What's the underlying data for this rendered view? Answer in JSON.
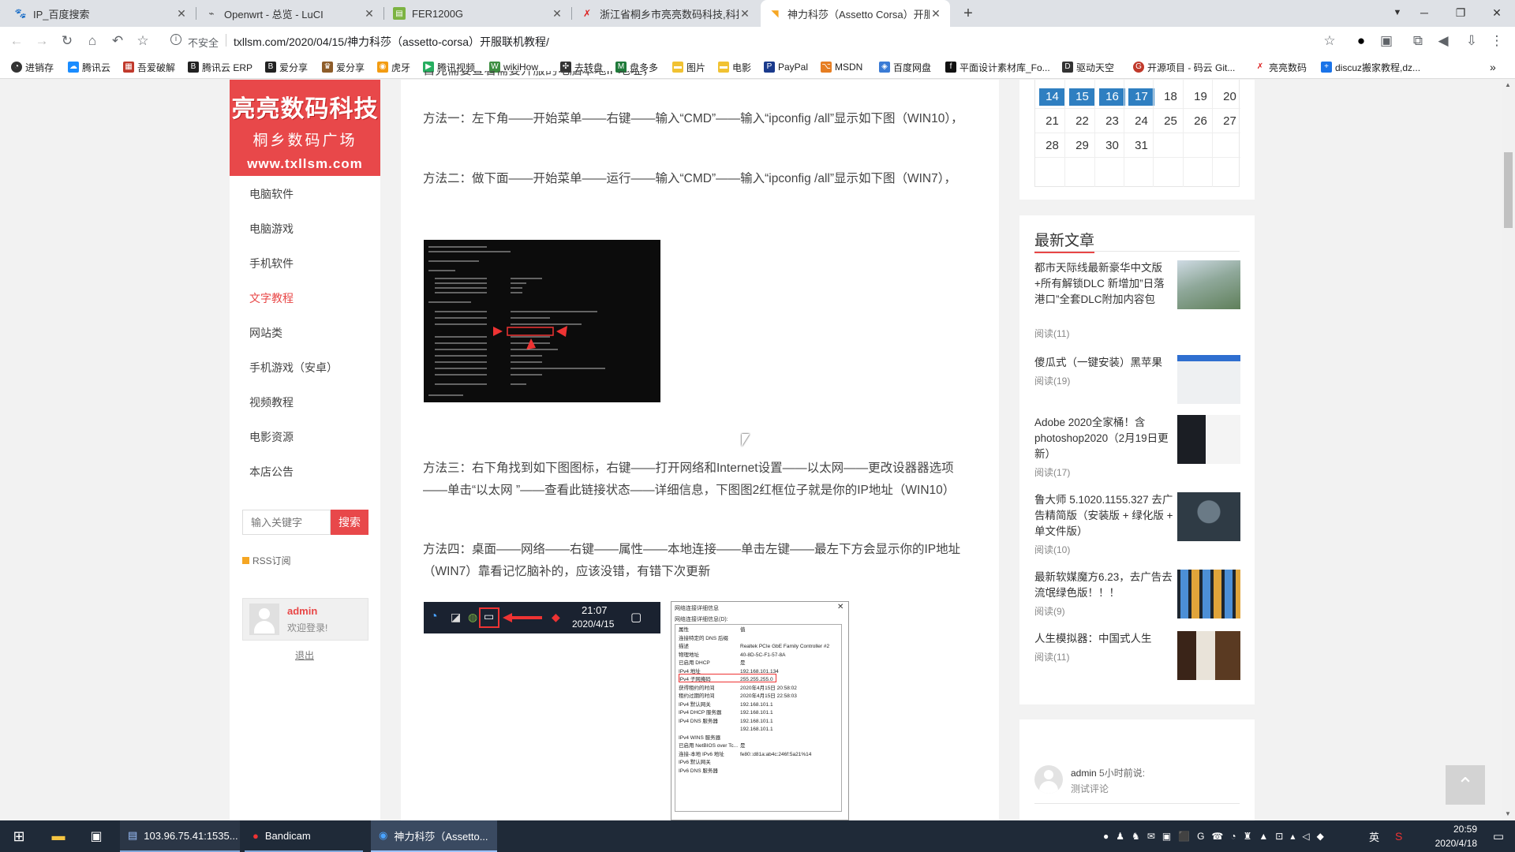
{
  "tabs": [
    {
      "title": "IP_百度搜索",
      "favicon": "baidu-icon"
    },
    {
      "title": "Openwrt - 总览 - LuCI",
      "favicon": "openwrt-icon"
    },
    {
      "title": "FER1200G",
      "favicon": "router-icon"
    },
    {
      "title": "浙江省桐乡市亮亮数码科技,科技",
      "favicon": "x-logo-icon"
    },
    {
      "title": "神力科莎（Assetto Corsa）开服",
      "favicon": "page-icon"
    }
  ],
  "omnibox": {
    "security": "不安全",
    "url": "txllsm.com/2020/04/15/神力科莎（assetto-corsa）开服联机教程/"
  },
  "bookmarks": [
    "进销存",
    "腾讯云",
    "吾爱破解",
    "腾讯云 ERP",
    "爱分享",
    "爱分享",
    "虎牙",
    "腾讯视频",
    "wikiHow",
    "去转盘",
    "盘多多",
    "图片",
    "电影",
    "PayPal",
    "MSDN",
    "百度网盘",
    "平面设计素材库_Fo...",
    "驱动天空",
    "开源项目 - 码云 Git...",
    "亮亮数码",
    "discuz搬家教程,dz..."
  ],
  "logo": {
    "line1": "亮亮数码科技",
    "line2": "桐乡数码广场",
    "line3": "www.txllsm.com"
  },
  "left_nav": [
    "电脑软件",
    "电脑游戏",
    "手机软件",
    "文字教程",
    "网站类",
    "手机游戏（安卓）",
    "视频教程",
    "电影资源",
    "本店公告"
  ],
  "search": {
    "placeholder": "输入关键字",
    "button": "搜索"
  },
  "rss": "RSS订阅",
  "user": {
    "name": "admin",
    "welcome": "欢迎登录!",
    "logout": "退出"
  },
  "article": {
    "top_text": "首先需要查看需要开服的电脑本地IP地址，",
    "method1": "方法一：左下角——开始菜单——右键——输入“CMD”——输入“ipconfig /all”显示如下图（WIN10），",
    "method2": "方法二：做下面——开始菜单——运行——输入“CMD”——输入“ipconfig /all”显示如下图（WIN7），",
    "method3": "方法三：右下角找到如下图图标，右键——打开网络和Internet设置——以太网——更改设器器选项——单击“以太网 ”——查看此链接状态——详细信息，下图图2红框位子就是你的IP地址（WIN10）",
    "method4": "方法四：桌面——网络——右键——属性——本地连接——单击左键——最左下方会显示你的IP地址（WIN7）靠看记忆脑补的，应该没错，有错下次更新",
    "tray_time": "21:07",
    "tray_date": "2020/4/15",
    "dialog_title": "网络连接详细信息",
    "dialog_subtitle": "网络连接详细信息(D):",
    "dialog_rows": [
      [
        "属性",
        "值"
      ],
      [
        "连接特定的 DNS 后缀",
        ""
      ],
      [
        "描述",
        "Realtek PCIe GbE Family Controller #2"
      ],
      [
        "物理地址",
        "40-8D-5C-F1-57-8A"
      ],
      [
        "已启用 DHCP",
        "是"
      ],
      [
        "IPv4 地址",
        "192.168.101.134"
      ],
      [
        "IPv4 子网掩码",
        "255.255.255.0"
      ],
      [
        "获得租约的时间",
        "2020年4月15日 20:58:02"
      ],
      [
        "租约过期的时间",
        "2020年4月15日 22:58:03"
      ],
      [
        "IPv4 默认网关",
        "192.168.101.1"
      ],
      [
        "IPv4 DHCP 服务器",
        "192.168.101.1"
      ],
      [
        "IPv4 DNS 服务器",
        "192.168.101.1"
      ],
      [
        "",
        "192.168.101.1"
      ],
      [
        "IPv4 WINS 服务器",
        ""
      ],
      [
        "已启用 NetBIOS over Tc...",
        "是"
      ],
      [
        "连接-本地 IPv6 地址",
        "fe80::d81a:ab4c:246f:5a21%14"
      ],
      [
        "IPv6 默认网关",
        ""
      ],
      [
        "IPv6 DNS 服务器",
        ""
      ]
    ]
  },
  "calendar": {
    "rows": [
      [
        {
          "d": "14",
          "hl": true
        },
        {
          "d": "15",
          "hl": true
        },
        {
          "d": "16",
          "hl": true
        },
        {
          "d": "17",
          "hl": true
        },
        {
          "d": "18",
          "hl": false
        },
        {
          "d": "19",
          "hl": false
        },
        {
          "d": "20",
          "hl": false
        }
      ],
      [
        {
          "d": "21",
          "hl": false
        },
        {
          "d": "22",
          "hl": false
        },
        {
          "d": "23",
          "hl": false
        },
        {
          "d": "24",
          "hl": false
        },
        {
          "d": "25",
          "hl": false
        },
        {
          "d": "26",
          "hl": false
        },
        {
          "d": "27",
          "hl": false
        }
      ],
      [
        {
          "d": "28",
          "hl": false
        },
        {
          "d": "29",
          "hl": false
        },
        {
          "d": "30",
          "hl": false
        },
        {
          "d": "31",
          "hl": false
        }
      ]
    ]
  },
  "latest": {
    "heading": "最新文章",
    "items": [
      {
        "title": "都市天际线最新豪华中文版+所有解锁DLC 新增加”日落港口”全套DLC附加内容包",
        "reads": "阅读(11)"
      },
      {
        "title": "傻瓜式（一键安装）黑苹果",
        "reads": "阅读(19)"
      },
      {
        "title": "Adobe 2020全家桶！含photoshop2020（2月19日更新）",
        "reads": "阅读(17)"
      },
      {
        "title": "鲁大师 5.1020.1155.327 去广告精简版（安装版 + 绿化版 + 单文件版）",
        "reads": "阅读(10)"
      },
      {
        "title": "最新软媒魔方6.23，去广告去流氓绿色版！！！",
        "reads": "阅读(9)"
      },
      {
        "title": "人生模拟器：中国式人生",
        "reads": "阅读(11)"
      }
    ]
  },
  "comment": {
    "user": "admin",
    "when": "5小时前说:",
    "text": "测试评论"
  },
  "taskbar": {
    "items": [
      "103.96.75.41:1535...",
      "Bandicam",
      "神力科莎（Assetto..."
    ],
    "time": "20:59",
    "date": "2020/4/18",
    "ime": "英"
  }
}
